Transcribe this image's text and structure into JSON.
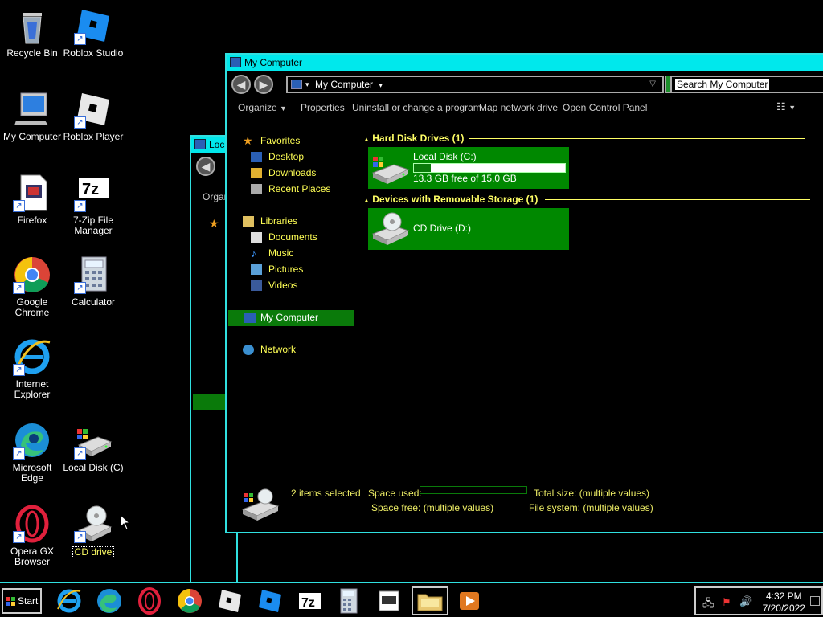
{
  "desktop": {
    "icons": [
      {
        "label": "Recycle Bin"
      },
      {
        "label": "Roblox Studio"
      },
      {
        "label": "My Computer"
      },
      {
        "label": "Roblox Player"
      },
      {
        "label": "Firefox"
      },
      {
        "label": "7-Zip File Manager"
      },
      {
        "label": "Google Chrome"
      },
      {
        "label": "Calculator"
      },
      {
        "label": "Internet Explorer"
      },
      {
        "label": "Microsoft Edge"
      },
      {
        "label": "Local Disk (C)"
      },
      {
        "label": "Opera GX Browser"
      },
      {
        "label": "CD drive"
      }
    ]
  },
  "back_window": {
    "title": "Loc",
    "cmd": "Organ"
  },
  "window": {
    "title": "My Computer",
    "address": "My Computer",
    "search_placeholder": "Search My Computer",
    "commands": [
      "Organize",
      "Properties",
      "Uninstall or change a program",
      "Map network drive",
      "Open Control Panel"
    ],
    "nav": {
      "favorites": "Favorites",
      "desktop": "Desktop",
      "downloads": "Downloads",
      "recent": "Recent Places",
      "libraries": "Libraries",
      "documents": "Documents",
      "music": "Music",
      "pictures": "Pictures",
      "videos": "Videos",
      "computer": "My Computer",
      "network": "Network"
    },
    "sections": {
      "hdd": "Hard Disk Drives (1)",
      "removable": "Devices with Removable Storage (1)"
    },
    "drives": {
      "c_name": "Local Disk (C:)",
      "c_free": "13.3 GB free of  15.0 GB",
      "c_used_fraction": 0.11,
      "d_name": "CD Drive (D:)"
    },
    "details": {
      "selected": "2 items selected",
      "space_used_label": "Space used:",
      "space_free": "Space free: (multiple values)",
      "total_size": "Total size: (multiple values)",
      "file_system": "File system: (multiple values)"
    }
  },
  "taskbar": {
    "start": "Start",
    "time": "4:32 PM",
    "date": "7/20/2022"
  },
  "colors": {
    "title_bar": "#00e8ec",
    "nav_text": "#ffff55",
    "tile_green": "#008800"
  }
}
